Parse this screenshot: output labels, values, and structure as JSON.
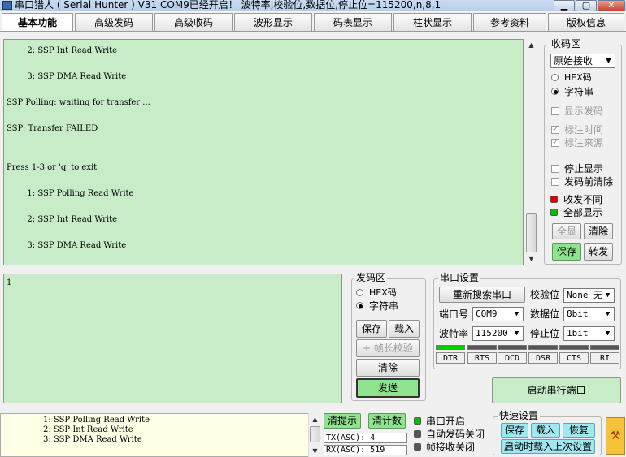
{
  "window": {
    "title": "串口猎人 ( Serial Hunter ) V31    COM9已经开启！ 波特率,校验位,数据位,停止位=115200,n,8,1"
  },
  "tabs": [
    "基本功能",
    "高级发码",
    "高级收码",
    "波形显示",
    "码表显示",
    "柱状显示",
    "参考资料",
    "版权信息"
  ],
  "receive_text": "        2: SSP Int Read Write\n\n        3: SSP DMA Read Write\n\nSSP Polling: waiting for transfer ...\n\nSSP: Transfer FAILED\n\n\nPress 1-3 or 'q' to exit\n\n        1: SSP Polling Read Write\n\n        2: SSP Int Read Write\n\n        3: SSP DMA Read Write",
  "recv_group": {
    "legend": "收码区",
    "mode_select": "原始接收",
    "hex_label": "HEX码",
    "str_label": "字符串",
    "show_send": "显示发码",
    "mark_time": "标注时间",
    "mark_source": "标注来源",
    "stop_display": "停止显示",
    "clear_before_send": "发码前清除",
    "recv_diff": "收发不同",
    "show_all": "全部显示",
    "btn_full": "全显",
    "btn_clear": "清除",
    "btn_save": "保存",
    "btn_forward": "转发"
  },
  "send_text": "1",
  "send_group": {
    "legend": "发码区",
    "hex_label": "HEX码",
    "str_label": "字符串",
    "btn_save": "保存",
    "btn_load": "载入",
    "btn_frame": "+ 帧长校验",
    "btn_clear": "清除",
    "btn_send": "发送"
  },
  "port_group": {
    "legend": "串口设置",
    "btn_research": "重新搜索串口",
    "parity_label": "校验位",
    "parity_value": "None 无",
    "port_label": "端口号",
    "port_value": "COM9",
    "data_label": "数据位",
    "data_value": "8bit",
    "baud_label": "波特率",
    "baud_value": "115200",
    "stop_label": "停止位",
    "stop_value": "1bit",
    "signals": [
      "DTR",
      "RTS",
      "DCD",
      "DSR",
      "CTS",
      "RI"
    ],
    "btn_open": "启动串行端口"
  },
  "bottom_text": "1: SSP Polling Read Write\n2: SSP Int Read Write\n3: SSP DMA Read Write",
  "bottom": {
    "btn_clear_tip": "清提示",
    "btn_clear_count": "清计数",
    "tx": "TX(ASC): 4",
    "rx": "RX(ASC): 519",
    "status_open": "串口开启",
    "status_auto_send": "自动发码关闭",
    "status_frame": "帧接收关闭"
  },
  "quick": {
    "legend": "快速设置",
    "btn_save": "保存",
    "btn_load": "载入",
    "btn_restore": "恢复",
    "btn_load_last": "启动时载入上次设置"
  },
  "colors": {
    "recv_bg": "#c8ebc8",
    "accent_green": "#8fe38f",
    "led_red": "#e00000",
    "led_green": "#00c000"
  }
}
